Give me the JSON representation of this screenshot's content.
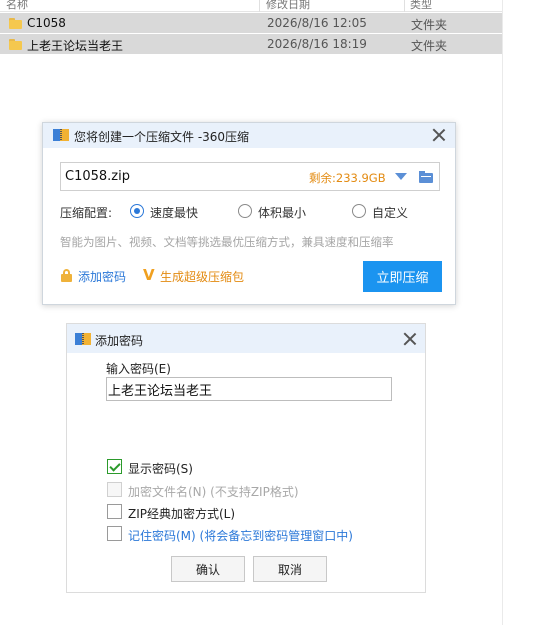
{
  "explorer": {
    "columns": {
      "name": "名称",
      "date": "修改日期",
      "type": "类型"
    },
    "rows": [
      {
        "name": "C1058",
        "date": "2026/8/16 12:05",
        "type": "文件夹"
      },
      {
        "name": "上老王论坛当老王",
        "date": "2026/8/16 18:19",
        "type": "文件夹"
      }
    ]
  },
  "zip_dialog": {
    "title": "您将创建一个压缩文件 -360压缩",
    "filename": "C1058.zip",
    "free_space": "剩余:233.9GB",
    "config_label": "压缩配置:",
    "options": [
      "速度最快",
      "体积最小",
      "自定义"
    ],
    "selected_option": "速度最快",
    "hint": "智能为图片、视频、文档等挑选最优压缩方式，兼具速度和压缩率",
    "add_password": "添加密码",
    "super_package": "生成超级压缩包",
    "compress_button": "立即压缩",
    "colors": {
      "accent": "#1b94f0",
      "link": "#2b78d8",
      "orange": "#e38b12"
    }
  },
  "password_dialog": {
    "title": "添加密码",
    "field_label": "输入密码(E)",
    "password_value": "上老王论坛当老王",
    "show_password": {
      "label": "显示密码(S)",
      "checked": true
    },
    "encrypt_filenames": {
      "label": "加密文件名(N) (不支持ZIP格式)",
      "checked": false,
      "disabled": true
    },
    "zip_classic": {
      "label": "ZIP经典加密方式(L)",
      "checked": false
    },
    "remember_password": {
      "label": "记住密码(M) (将会备忘到密码管理窗口中)",
      "checked": false
    },
    "ok_button": "确认",
    "cancel_button": "取消"
  }
}
